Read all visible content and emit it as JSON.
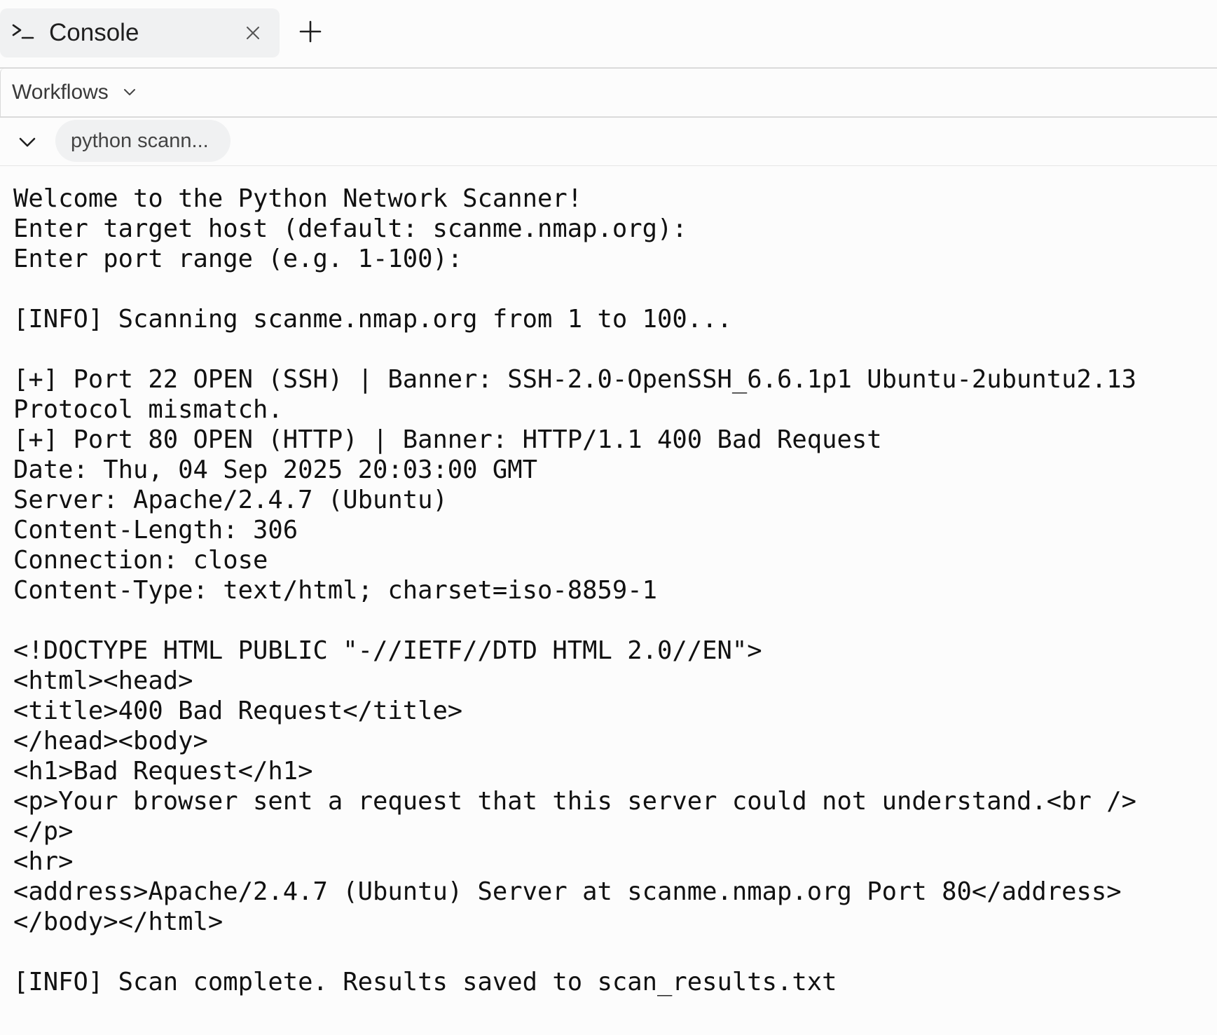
{
  "tab": {
    "icon": "terminal-prompt-icon",
    "label": "Console",
    "close_icon": "close-icon",
    "new_tab_icon": "plus-icon"
  },
  "toolbar": {
    "workflows_label": "Workflows",
    "workflows_icon": "chevron-down-icon"
  },
  "run": {
    "collapse_icon": "chevron-down-icon",
    "label": "python scann..."
  },
  "console": {
    "lines": [
      "Welcome to the Python Network Scanner!",
      "Enter target host (default: scanme.nmap.org):",
      "Enter port range (e.g. 1-100):",
      "",
      "[INFO] Scanning scanme.nmap.org from 1 to 100...",
      "",
      "[+] Port 22 OPEN (SSH) | Banner: SSH-2.0-OpenSSH_6.6.1p1 Ubuntu-2ubuntu2.13",
      "Protocol mismatch.",
      "[+] Port 80 OPEN (HTTP) | Banner: HTTP/1.1 400 Bad Request",
      "Date: Thu, 04 Sep 2025 20:03:00 GMT",
      "Server: Apache/2.4.7 (Ubuntu)",
      "Content-Length: 306",
      "Connection: close",
      "Content-Type: text/html; charset=iso-8859-1",
      "",
      "<!DOCTYPE HTML PUBLIC \"-//IETF//DTD HTML 2.0//EN\">",
      "<html><head>",
      "<title>400 Bad Request</title>",
      "</head><body>",
      "<h1>Bad Request</h1>",
      "<p>Your browser sent a request that this server could not understand.<br />",
      "</p>",
      "<hr>",
      "<address>Apache/2.4.7 (Ubuntu) Server at scanme.nmap.org Port 80</address>",
      "</body></html>",
      "",
      "[INFO] Scan complete. Results saved to scan_results.txt"
    ]
  }
}
